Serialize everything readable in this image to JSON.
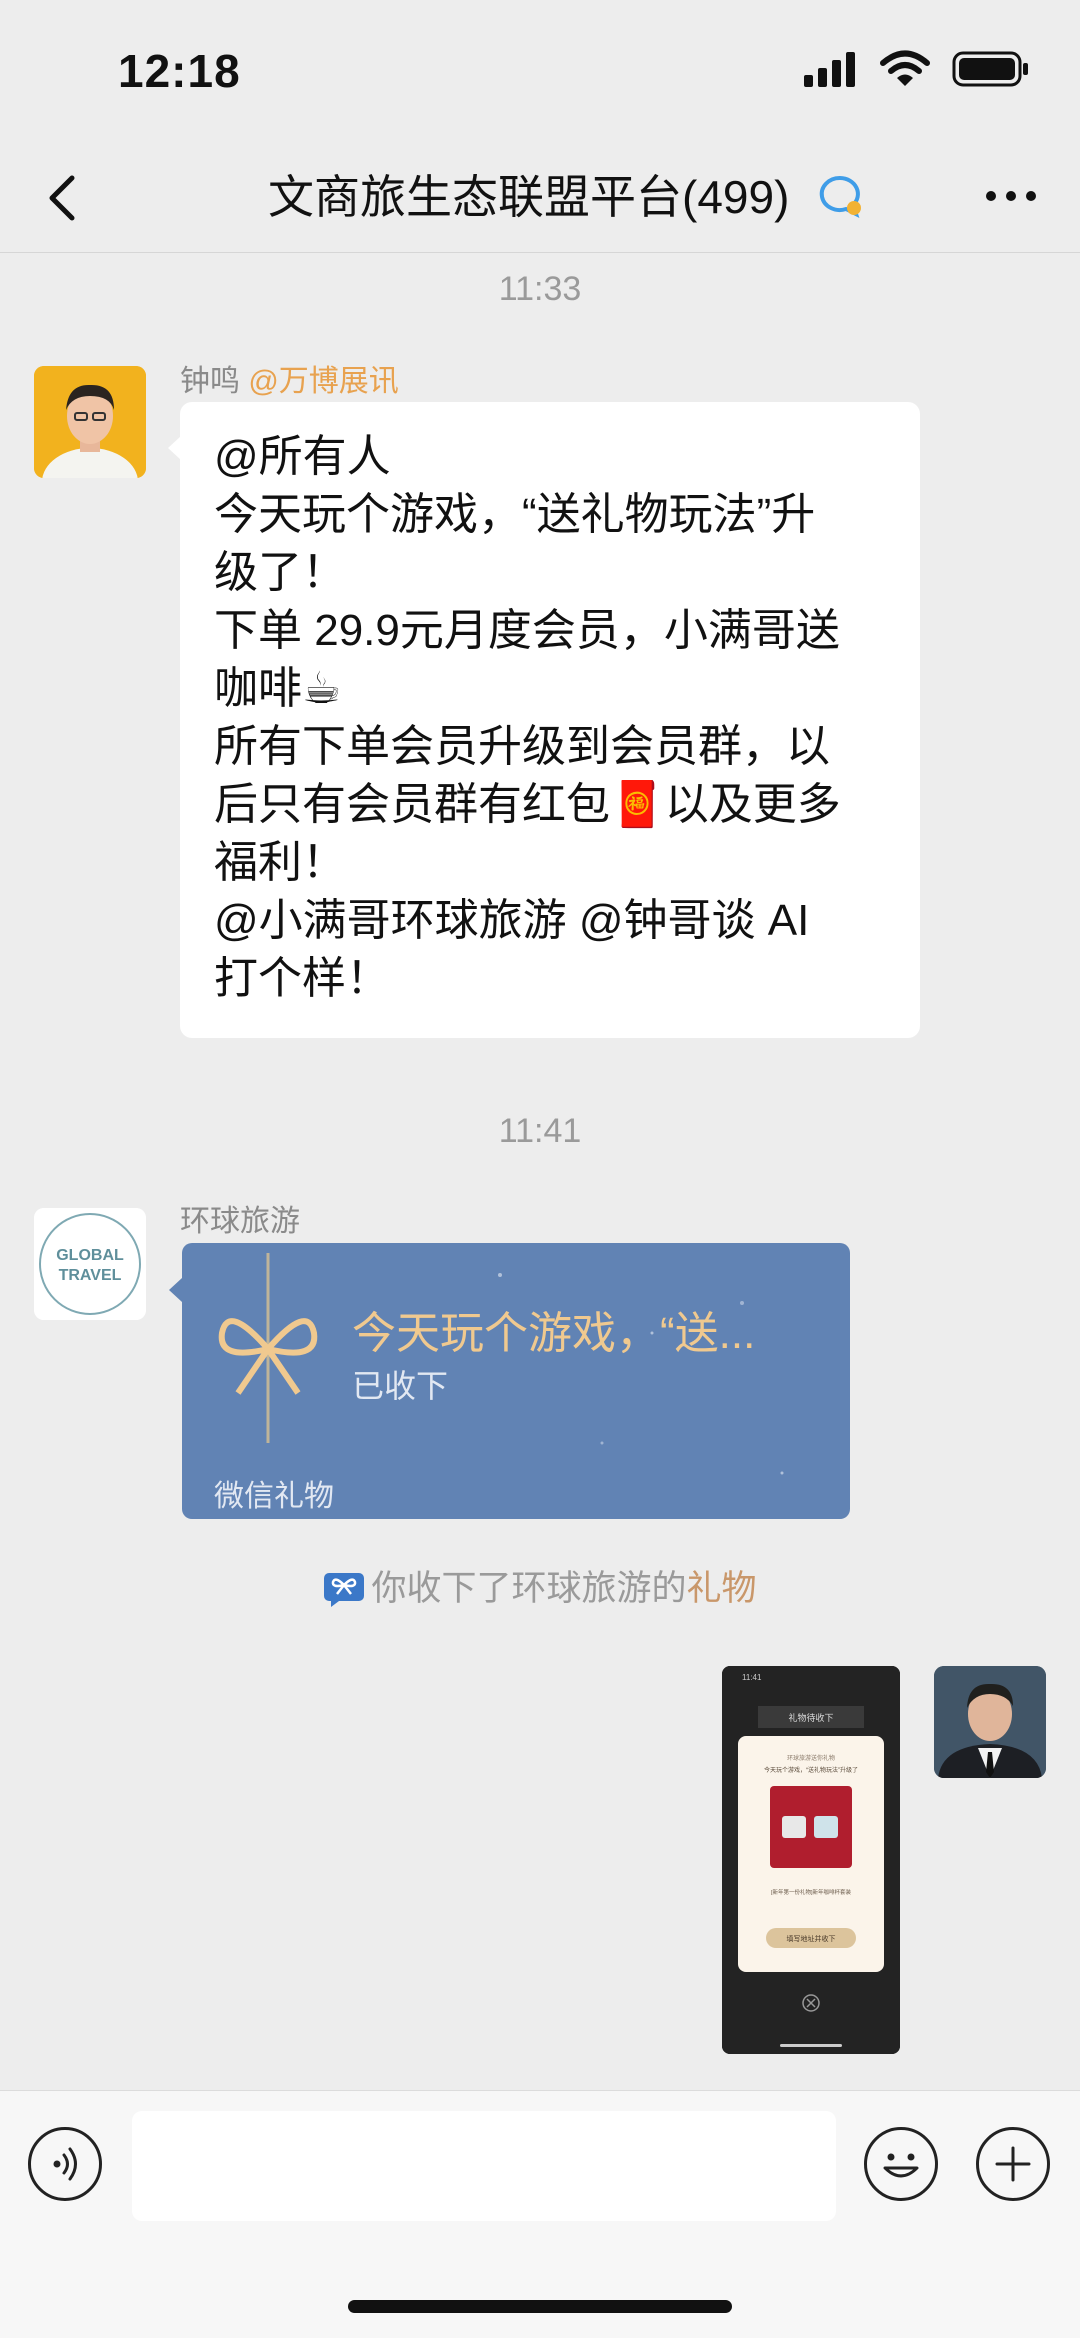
{
  "status_bar": {
    "time": "12:18"
  },
  "header": {
    "title": "文商旅生态联盟平台(499)"
  },
  "messages": {
    "ts1": "11:33",
    "msg1": {
      "sender": "钟鸣",
      "mention": "@万博展讯",
      "lines": [
        "@所有人",
        "今天玩个游戏，“送礼物玩法”升",
        "级了！",
        "下单 29.9元月度会员，小满哥送",
        "咖啡☕",
        "所有下单会员升级到会员群，以",
        "后只有会员群有红包🧧以及更多",
        "福利！",
        "@小满哥环球旅游 @钟哥谈 AI",
        "打个样！"
      ]
    },
    "ts2": "11:41",
    "msg2": {
      "sender": "环球旅游",
      "avatar_text_1": "GLOBAL",
      "avatar_text_2": "TRAVEL",
      "gift_title": "今天玩个游戏，“送...",
      "gift_status": "已收下",
      "gift_footer": "微信礼物"
    },
    "notice": {
      "prefix": "你收下了环球旅游的",
      "link": "礼物"
    },
    "screenshot": {
      "time": "11:41",
      "header": "礼物待收下",
      "line1": "环球旅游送你礼物",
      "line2": "今天玩个游戏，“送礼物玩法”升级了",
      "caption": "[新年第一份礼物]新年咖啡杯套装",
      "button": "填写地址并收下"
    }
  },
  "colors": {
    "accent_mention": "#e8a24f",
    "gift_bg": "#6183b4",
    "gift_gold": "#f0c98f"
  }
}
